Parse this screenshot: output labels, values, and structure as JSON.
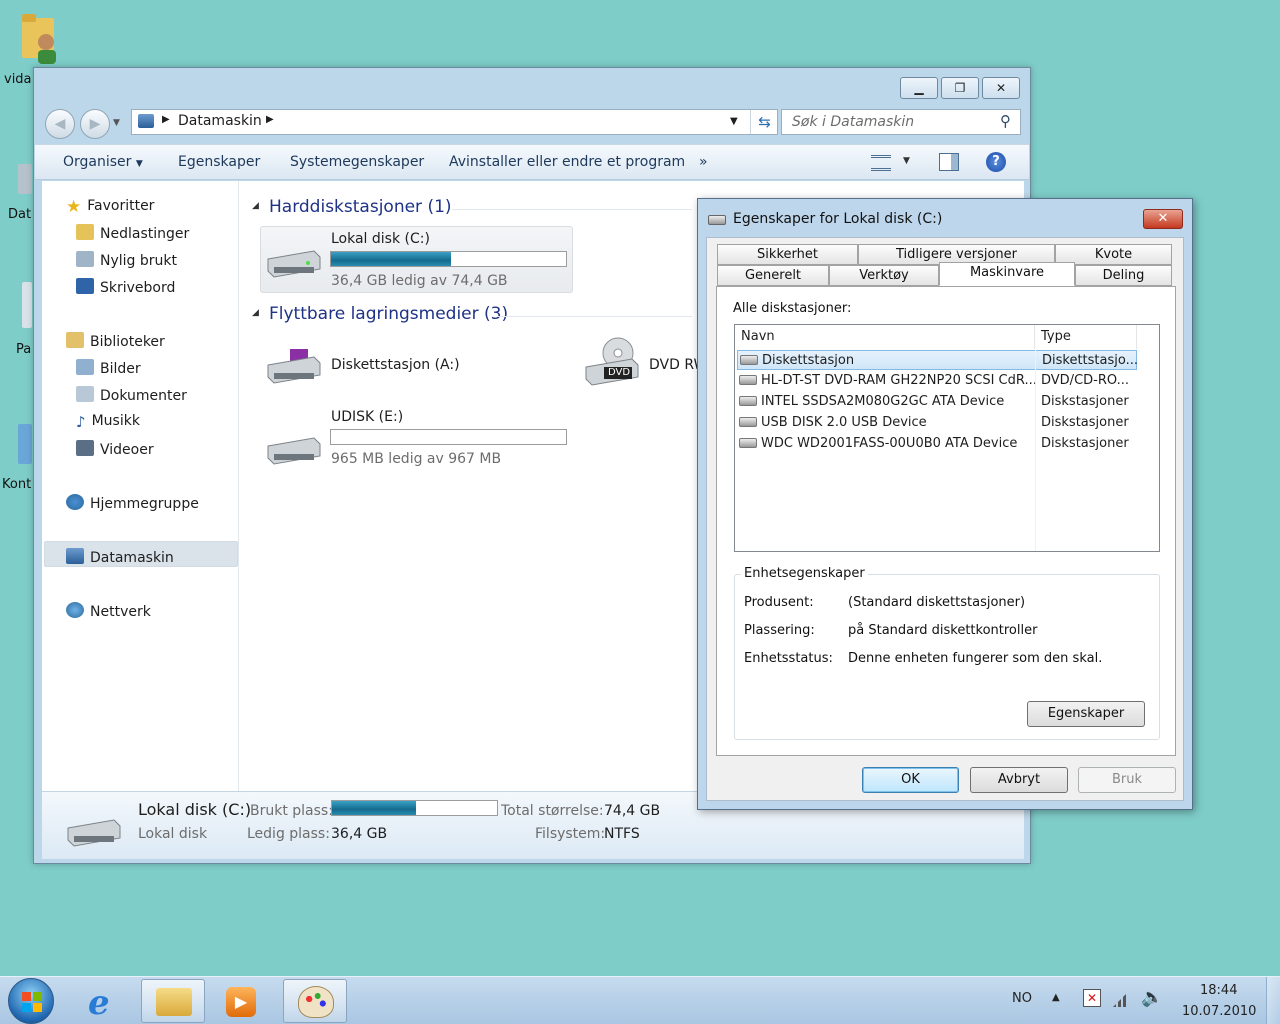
{
  "desktop": {
    "icons": [
      "vida",
      "Dat",
      "Pa",
      "Kont"
    ]
  },
  "explorer": {
    "address": {
      "segment": "Datamaskin"
    },
    "search_placeholder": "Søk i Datamaskin",
    "toolbar": {
      "organize": "Organiser",
      "properties": "Egenskaper",
      "system_properties": "Systemegenskaper",
      "uninstall": "Avinstaller eller endre et program",
      "more": "»"
    },
    "nav": {
      "favorites": "Favoritter",
      "downloads": "Nedlastinger",
      "recent": "Nylig brukt",
      "desktop": "Skrivebord",
      "libraries": "Biblioteker",
      "pictures": "Bilder",
      "documents": "Dokumenter",
      "music": "Musikk",
      "videos": "Videoer",
      "homegroup": "Hjemmegruppe",
      "computer": "Datamaskin",
      "network": "Nettverk"
    },
    "groups": {
      "hard_drives": "Harddiskstasjoner (1)",
      "removable": "Flyttbare lagringsmedier (3)"
    },
    "drives": {
      "c": {
        "name": "Lokal disk (C:)",
        "free": "36,4 GB ledig av 74,4 GB",
        "used_fraction": 0.51
      },
      "a": {
        "name": "Diskettstasjon (A:)"
      },
      "dvd": {
        "name": "DVD RW",
        "disc_label": "DVD"
      },
      "e": {
        "name": "UDISK (E:)",
        "free": "965 MB ledig av 967 MB",
        "used_fraction": 0.002
      }
    },
    "details": {
      "name": "Lokal disk (C:)",
      "type": "Lokal disk",
      "used_label": "Brukt plass:",
      "free_label": "Ledig plass:",
      "free_value": "36,4 GB",
      "total_label": "Total størrelse:",
      "total_value": "74,4 GB",
      "fs_label": "Filsystem:",
      "fs_value": "NTFS",
      "used_fraction": 0.51
    }
  },
  "dialog": {
    "title": "Egenskaper for Lokal disk (C:)",
    "close": "✕",
    "tabs_row1": [
      "Sikkerhet",
      "Tidligere versjoner",
      "Kvote"
    ],
    "tabs_row2": [
      "Generelt",
      "Verktøy",
      "Maskinvare",
      "Deling"
    ],
    "active_tab": "Maskinvare",
    "all_drives_label": "Alle diskstasjoner:",
    "columns": [
      "Navn",
      "Type"
    ],
    "rows": [
      {
        "name": "Diskettstasjon",
        "type": "Diskettstasjo..."
      },
      {
        "name": "HL-DT-ST DVD-RAM GH22NP20 SCSI CdR...",
        "type": "DVD/CD-RO..."
      },
      {
        "name": "INTEL SSDSA2M080G2GC ATA Device",
        "type": "Diskstasjoner"
      },
      {
        "name": "USB DISK 2.0 USB Device",
        "type": "Diskstasjoner"
      },
      {
        "name": "WDC WD2001FASS-00U0B0 ATA Device",
        "type": "Diskstasjoner"
      }
    ],
    "device_props": {
      "legend": "Enhetsegenskaper",
      "manufacturer_label": "Produsent:",
      "manufacturer_value": "(Standard diskettstasjoner)",
      "location_label": "Plassering:",
      "location_value": "på Standard diskettkontroller",
      "status_label": "Enhetsstatus:",
      "status_value": "Denne enheten fungerer som den skal.",
      "properties_button": "Egenskaper"
    },
    "buttons": {
      "ok": "OK",
      "cancel": "Avbryt",
      "apply": "Bruk"
    }
  },
  "taskbar": {
    "language": "NO",
    "time": "18:44",
    "date": "10.07.2010"
  }
}
